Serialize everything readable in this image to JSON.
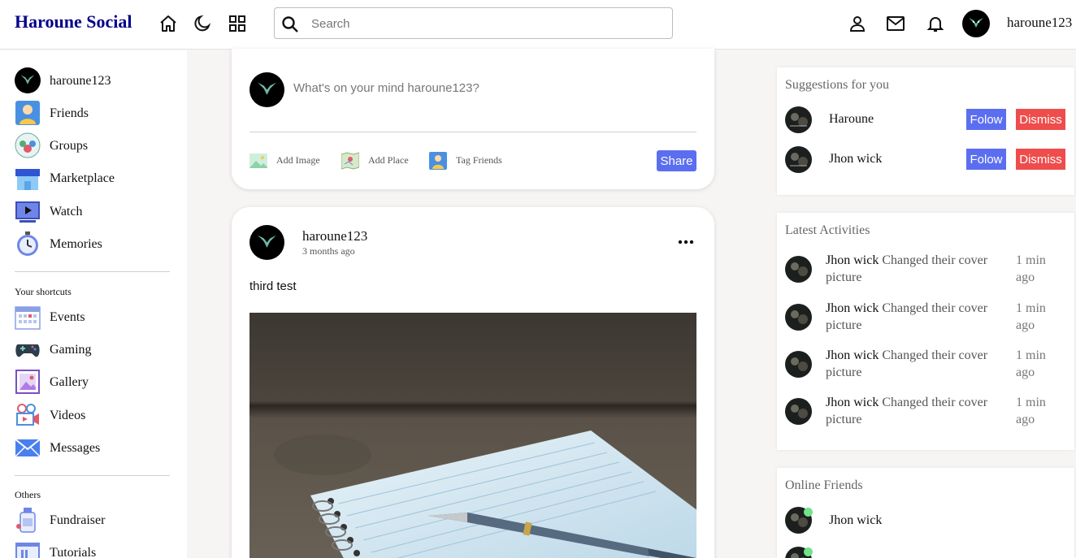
{
  "navbar": {
    "logo": "Haroune Social",
    "search_placeholder": "Search",
    "username": "haroune123",
    "icons": [
      "home-icon",
      "moon-icon",
      "grid-icon",
      "search-icon",
      "person-icon",
      "mail-icon",
      "bell-icon"
    ]
  },
  "leftbar": {
    "profile_label": "haroune123",
    "items": [
      {
        "label": "Friends",
        "icon": "friends-icon"
      },
      {
        "label": "Groups",
        "icon": "groups-icon"
      },
      {
        "label": "Marketplace",
        "icon": "marketplace-icon"
      },
      {
        "label": "Watch",
        "icon": "watch-icon"
      },
      {
        "label": "Memories",
        "icon": "memories-icon"
      }
    ],
    "shortcuts_title": "Your shortcuts",
    "shortcuts": [
      {
        "label": "Events",
        "icon": "events-icon"
      },
      {
        "label": "Gaming",
        "icon": "gaming-icon"
      },
      {
        "label": "Gallery",
        "icon": "gallery-icon"
      },
      {
        "label": "Videos",
        "icon": "videos-icon"
      },
      {
        "label": "Messages",
        "icon": "messages-icon"
      }
    ],
    "others_title": "Others",
    "others": [
      {
        "label": "Fundraiser",
        "icon": "fundraiser-icon"
      },
      {
        "label": "Tutorials",
        "icon": "tutorials-icon"
      }
    ]
  },
  "create_post": {
    "placeholder": "What's on your mind haroune123?",
    "actions": [
      {
        "label": "Add Image",
        "icon": "image-icon"
      },
      {
        "label": "Add Place",
        "icon": "map-icon"
      },
      {
        "label": "Tag Friends",
        "icon": "tag-friends-icon"
      }
    ],
    "share_label": "Share"
  },
  "post": {
    "author": "haroune123",
    "time": "3 months ago",
    "text": "third test",
    "image_subject": "notebook and fountain pen on wooden table"
  },
  "suggestions": {
    "title": "Suggestions for you",
    "items": [
      {
        "name": "Haroune",
        "follow_label": "Folow",
        "dismiss_label": "Dismiss"
      },
      {
        "name": "Jhon wick",
        "follow_label": "Folow",
        "dismiss_label": "Dismiss"
      }
    ]
  },
  "activities": {
    "title": "Latest Activities",
    "items": [
      {
        "name": "Jhon wick",
        "action": "Changed their cover picture",
        "time": "1 min ago"
      },
      {
        "name": "Jhon wick",
        "action": "Changed their cover picture",
        "time": "1 min ago"
      },
      {
        "name": "Jhon wick",
        "action": "Changed their cover picture",
        "time": "1 min ago"
      },
      {
        "name": "Jhon wick",
        "action": "Changed their cover picture",
        "time": "1 min ago"
      }
    ]
  },
  "online_friends": {
    "title": "Online Friends",
    "items": [
      {
        "name": "Jhon wick"
      }
    ]
  },
  "colors": {
    "logo": "#00008b",
    "primary_button": "#5b6ef0",
    "dismiss_button": "#ef4c4c",
    "online_dot": "#73e28a"
  }
}
